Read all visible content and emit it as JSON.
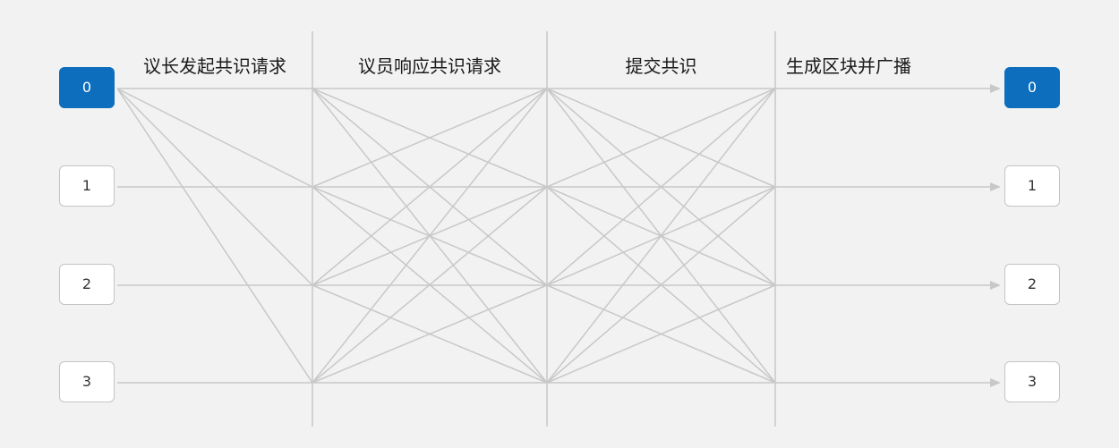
{
  "phases": [
    "议长发起共识请求",
    "议员响应共识请求",
    "提交共识",
    "生成区块并广播"
  ],
  "nodes": {
    "left": [
      "0",
      "1",
      "2",
      "3"
    ],
    "right": [
      "0",
      "1",
      "2",
      "3"
    ]
  },
  "primary_node": "0",
  "colors": {
    "background": "#f2f2f2",
    "line": "#c8c8c8",
    "primary_fill": "#0c6ebd",
    "node_fill": "#ffffff",
    "node_border": "#c4c4c4"
  }
}
